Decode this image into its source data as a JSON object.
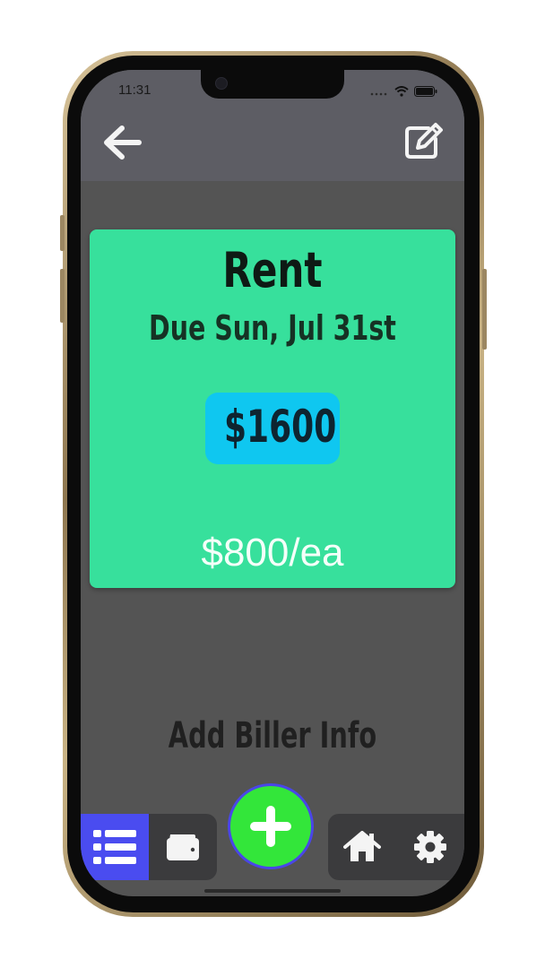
{
  "status_bar": {
    "time": "11:31",
    "icons": [
      "cellular-dots-icon",
      "wifi-icon",
      "battery-icon"
    ]
  },
  "header": {
    "back_icon": "arrow-left-icon",
    "edit_icon": "edit-icon"
  },
  "bill": {
    "title": "Rent",
    "due": "Due Sun, Jul 31st",
    "amount": "$1600",
    "split": "$800/ea"
  },
  "biller": {
    "label": "Add Biller Info"
  },
  "tab_bar": {
    "items": [
      {
        "icon": "list-icon",
        "active": true
      },
      {
        "icon": "wallet-icon",
        "active": false
      },
      {
        "icon": "plus-icon",
        "active": false
      },
      {
        "icon": "home-icon",
        "active": false
      },
      {
        "icon": "gear-icon",
        "active": false
      }
    ]
  },
  "colors": {
    "card_bg": "#37e09c",
    "amount_pill": "#0fc7f0",
    "active_tab": "#4a4cf0",
    "fab": "#33e63a",
    "screen_bg": "#545454"
  }
}
